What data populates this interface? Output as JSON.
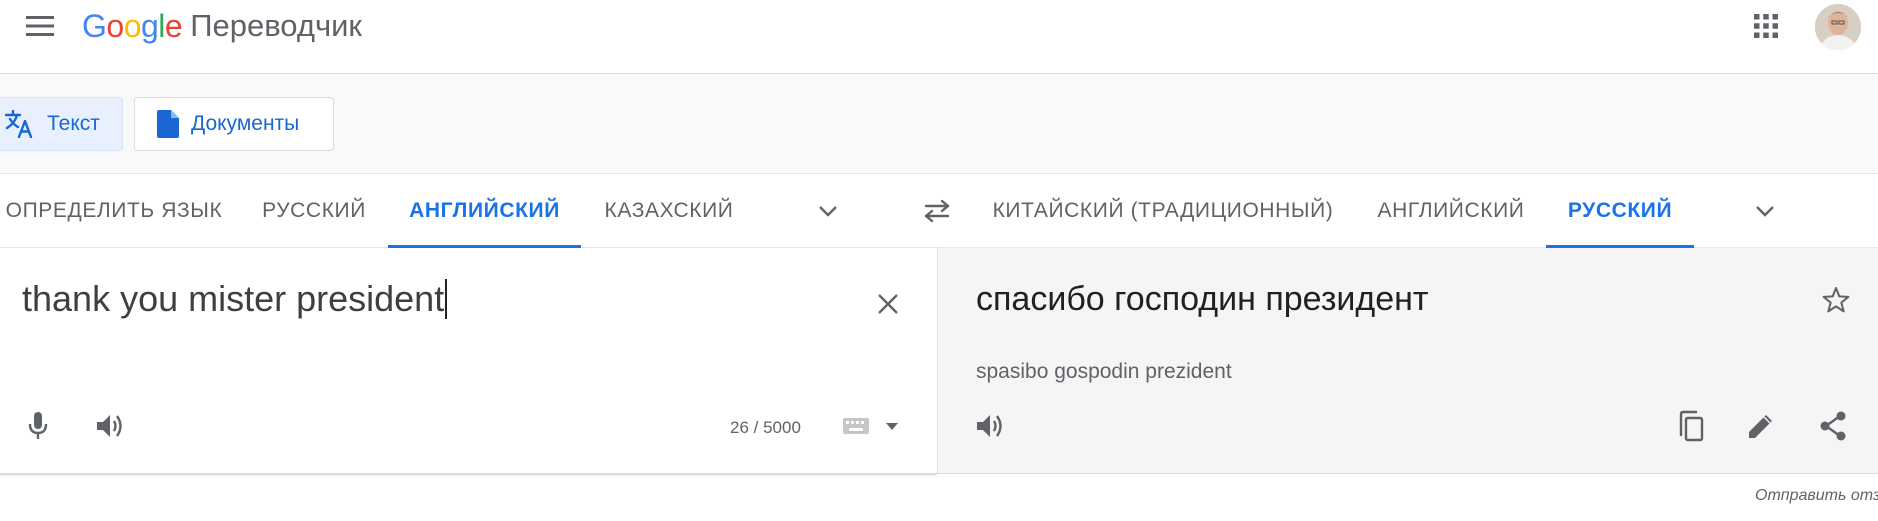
{
  "header": {
    "logo_google": "Google",
    "product_name": "Переводчик",
    "menu_icon": "menu-icon",
    "apps_icon": "apps-grid-icon",
    "avatar_icon": "user-avatar"
  },
  "modes": [
    {
      "label": "Текст",
      "icon": "translate-icon",
      "selected": true
    },
    {
      "label": "Документы",
      "icon": "document-icon",
      "selected": false
    }
  ],
  "source_languages": [
    "ОПРЕДЕЛИТЬ ЯЗЫК",
    "РУССКИЙ",
    "АНГЛИЙСКИЙ",
    "КАЗАХСКИЙ"
  ],
  "source_selected": "АНГЛИЙСКИЙ",
  "target_languages": [
    "КИТАЙСКИЙ (ТРАДИЦИОННЫЙ)",
    "АНГЛИЙСКИЙ",
    "РУССКИЙ"
  ],
  "target_selected": "РУССКИЙ",
  "source": {
    "text": "thank you mister president",
    "char_count": "26 / 5000"
  },
  "target": {
    "text": "спасибо господин президент",
    "transliteration": "spasibo gospodin prezident"
  },
  "footer": {
    "feedback": "Отправить отзыв"
  },
  "colors": {
    "accent": "#1a73e8",
    "mode_selected_bg": "#e8f0fe",
    "muted_text": "#5f6368",
    "icon": "#5f6368",
    "target_bg": "#f5f5f5"
  }
}
